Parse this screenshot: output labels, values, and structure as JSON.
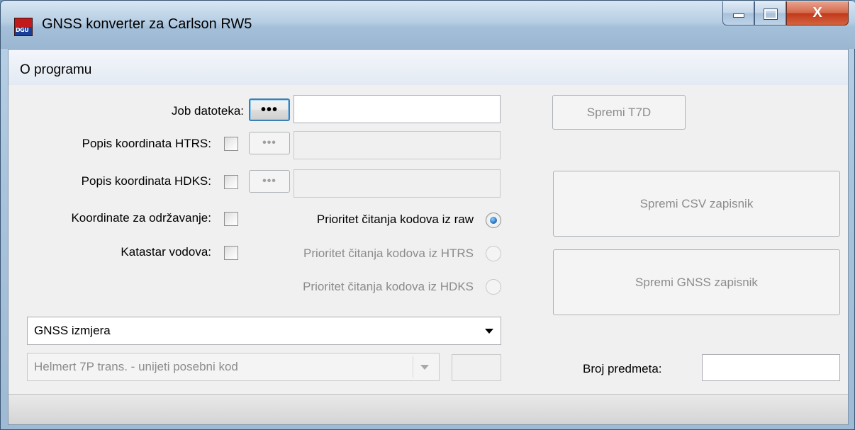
{
  "window": {
    "title": "GNSS konverter za Carlson RW5",
    "close_glyph": "X"
  },
  "menu": {
    "items": [
      {
        "label": "O programu"
      }
    ]
  },
  "form": {
    "job_label": "Job datoteka:",
    "htrs_label": "Popis koordinata HTRS:",
    "hdks_label": "Popis koordinata HDKS:",
    "maintenance_label": "Koordinate za održavanje:",
    "cadastre_label": "Katastar vodova:",
    "browse_label": "•••",
    "radio_raw": "Prioritet čitanja kodova iz raw",
    "radio_htrs": "Prioritet čitanja kodova iz HTRS",
    "radio_hdks": "Prioritet čitanja kodova iz HDKS",
    "survey_type": "GNSS izmjera",
    "transformation": "Helmert 7P trans. - unijeti posebni kod",
    "case_number_label": "Broj predmeta:"
  },
  "buttons": {
    "save_t7d": "Spremi T7D",
    "save_csv": "Spremi CSV zapisnik",
    "save_gnss": "Spremi GNSS zapisnik"
  }
}
